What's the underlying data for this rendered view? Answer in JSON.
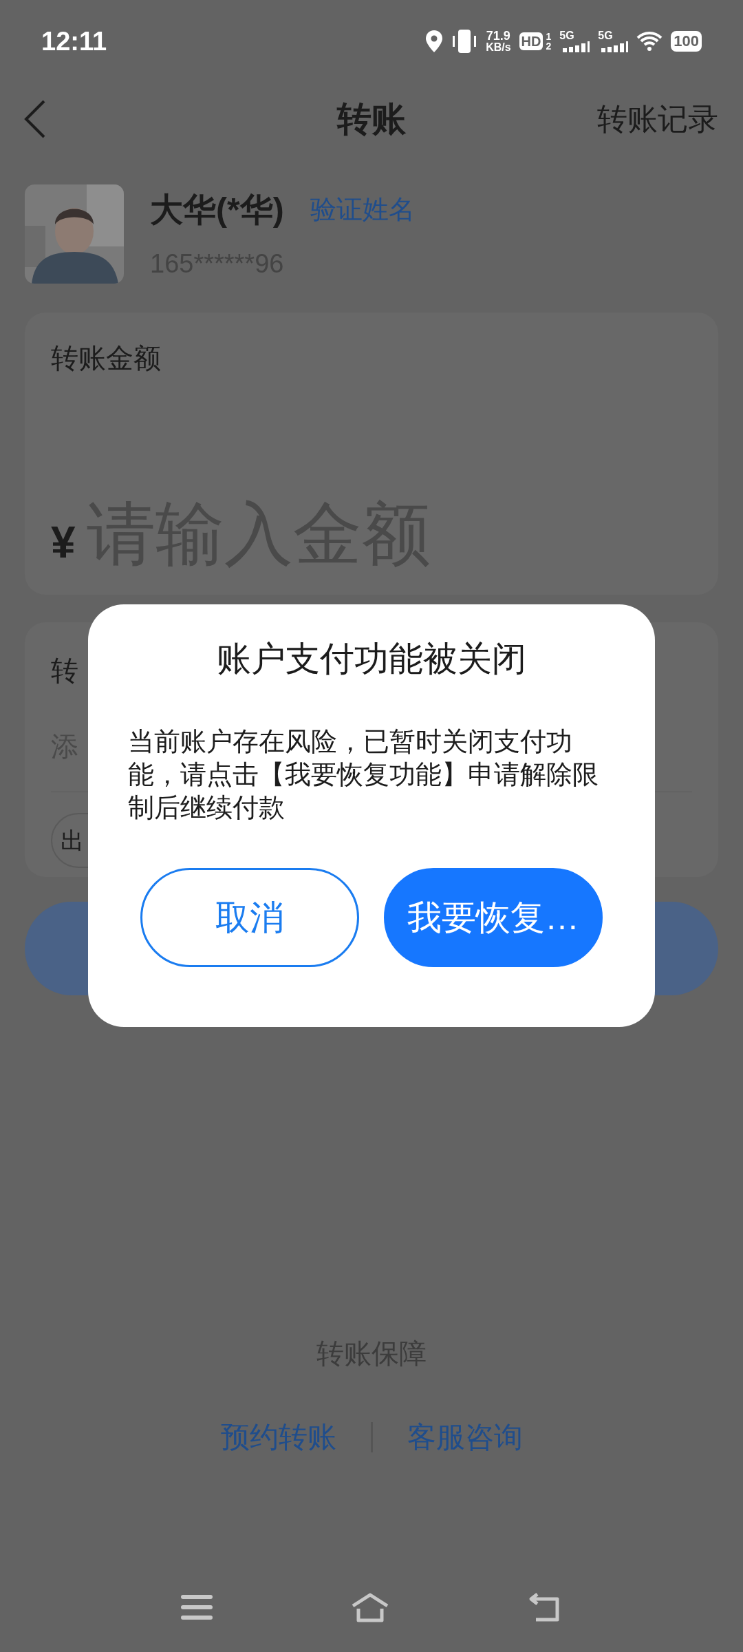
{
  "status_bar": {
    "time": "12:11",
    "speed": "71.9",
    "speed_unit": "KB/s",
    "hd_badge": "HD",
    "hd_marks": [
      "1",
      "2"
    ],
    "sim_networks": [
      "5G",
      "5G"
    ],
    "battery": "100"
  },
  "header": {
    "title": "转账",
    "action": "转账记录"
  },
  "payee": {
    "name": "大华(*华)",
    "verify_link": "验证姓名",
    "account": "165******96"
  },
  "amount_card": {
    "label": "转账金额",
    "currency": "¥",
    "placeholder": "请输入金额"
  },
  "note_card": {
    "label": "转",
    "placeholder": "添",
    "chip": "出"
  },
  "dialog": {
    "title": "账户支付功能被关闭",
    "message": "当前账户存在风险，已暂时关闭支付功能，请点击【我要恢复功能】申请解除限制后继续付款",
    "buttons": [
      {
        "label": "取消",
        "kind": "secondary"
      },
      {
        "label": "我要恢复…",
        "kind": "primary"
      }
    ]
  },
  "footer": {
    "guarantee": "转账保障",
    "links": [
      "预约转账",
      "客服咨询"
    ]
  }
}
